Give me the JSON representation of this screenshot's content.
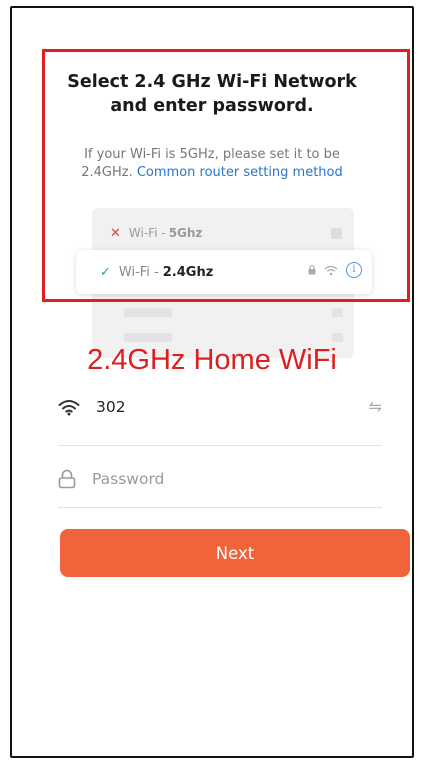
{
  "header": {
    "title_line1": "Select 2.4 GHz Wi-Fi Network",
    "title_line2": "and enter password.",
    "subtitle_line1": "If your Wi-Fi is 5GHz, please set it to be",
    "subtitle_prefix": "2.4GHz.",
    "subtitle_link": "Common router setting method"
  },
  "illustration": {
    "network_5g_prefix": "Wi-Fi - ",
    "network_5g_band": "5Ghz",
    "network_24_prefix": "Wi-Fi - ",
    "network_24_band": "2.4Ghz"
  },
  "annotation": {
    "label": "2.4GHz Home WiFi",
    "box_color": "#e02020"
  },
  "form": {
    "ssid_value": "302",
    "password_placeholder": "Password",
    "password_value": "",
    "next_label": "Next"
  },
  "colors": {
    "accent": "#f0633b",
    "link": "#2a74c4"
  }
}
